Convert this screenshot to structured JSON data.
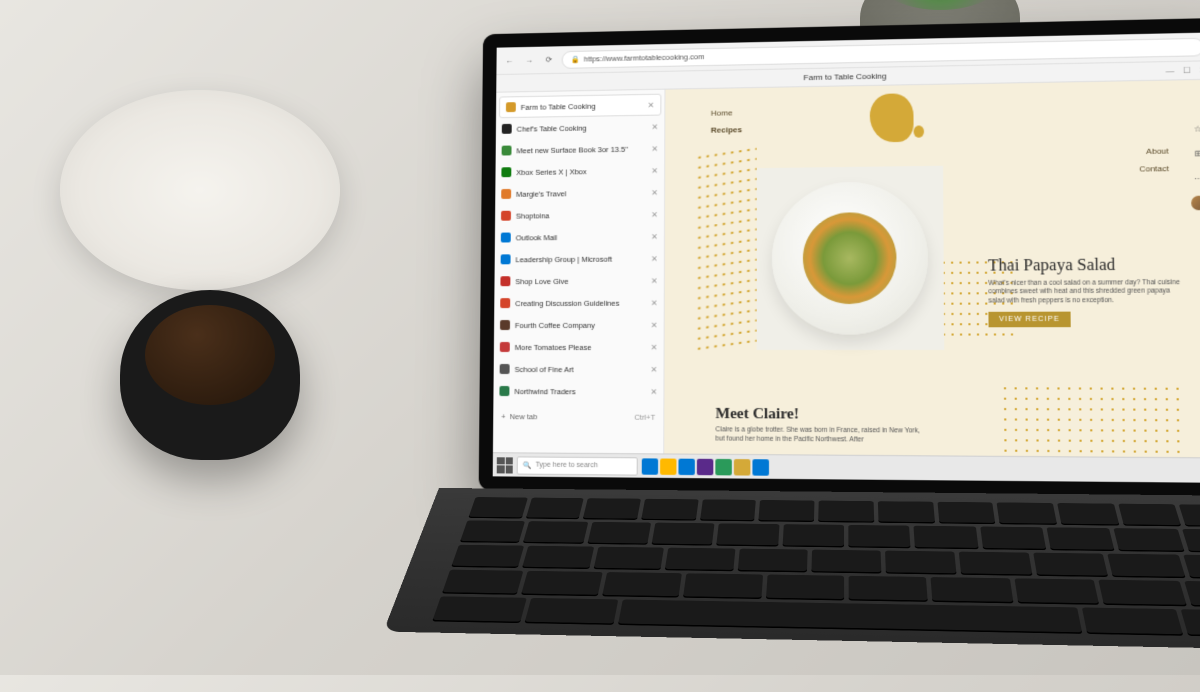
{
  "browser": {
    "address": "https://www.farmtotablecooking.com",
    "page_title": "Farm to Table Cooking",
    "tabs": [
      {
        "label": "Farm to Table Cooking",
        "color": "#d49a2a",
        "active": true
      },
      {
        "label": "Chef's Table Cooking",
        "color": "#222"
      },
      {
        "label": "Meet new Surface Book 3or 13.5\"",
        "color": "#3a8a3a"
      },
      {
        "label": "Xbox Series X | Xbox",
        "color": "#107c10"
      },
      {
        "label": "Margie's Travel",
        "color": "#e07a2a"
      },
      {
        "label": "Shoptoina",
        "color": "#d4442a"
      },
      {
        "label": "Outlook Mail",
        "color": "#0078d4"
      },
      {
        "label": "Leadership Group | Microsoft",
        "color": "#0078d4"
      },
      {
        "label": "Shop Love Give",
        "color": "#c4302a"
      },
      {
        "label": "Creating Discussion Guidelines",
        "color": "#d4442a"
      },
      {
        "label": "Fourth Coffee Company",
        "color": "#5a3a2a"
      },
      {
        "label": "More Tomatoes Please",
        "color": "#c43a3a"
      },
      {
        "label": "School of Fine Art",
        "color": "#555"
      },
      {
        "label": "Northwind Traders",
        "color": "#2a7a4a"
      }
    ],
    "new_tab_label": "New tab",
    "new_tab_shortcut": "Ctrl+T"
  },
  "page": {
    "nav": {
      "home": "Home",
      "recipes": "Recipes",
      "about": "About",
      "contact": "Contact"
    },
    "recipe": {
      "title": "Thai Papaya Salad",
      "description": "What's nicer than a cool salad on a summer day? Thai cuisine combines sweet with heat and this shredded green papaya salad with fresh peppers is no exception.",
      "button": "VIEW RECIPE"
    },
    "meet": {
      "heading": "Meet Claire!",
      "body": "Claire is a globe trotter. She was born in France, raised in New York, but found her home in the Pacific Northwest. After"
    }
  },
  "taskbar": {
    "search_placeholder": "Type here to search",
    "icons": [
      "#0078d4",
      "#ffb900",
      "#0078d4",
      "#5a2a8a",
      "#2a9a5a",
      "#d4a938",
      "#0078d4"
    ]
  }
}
